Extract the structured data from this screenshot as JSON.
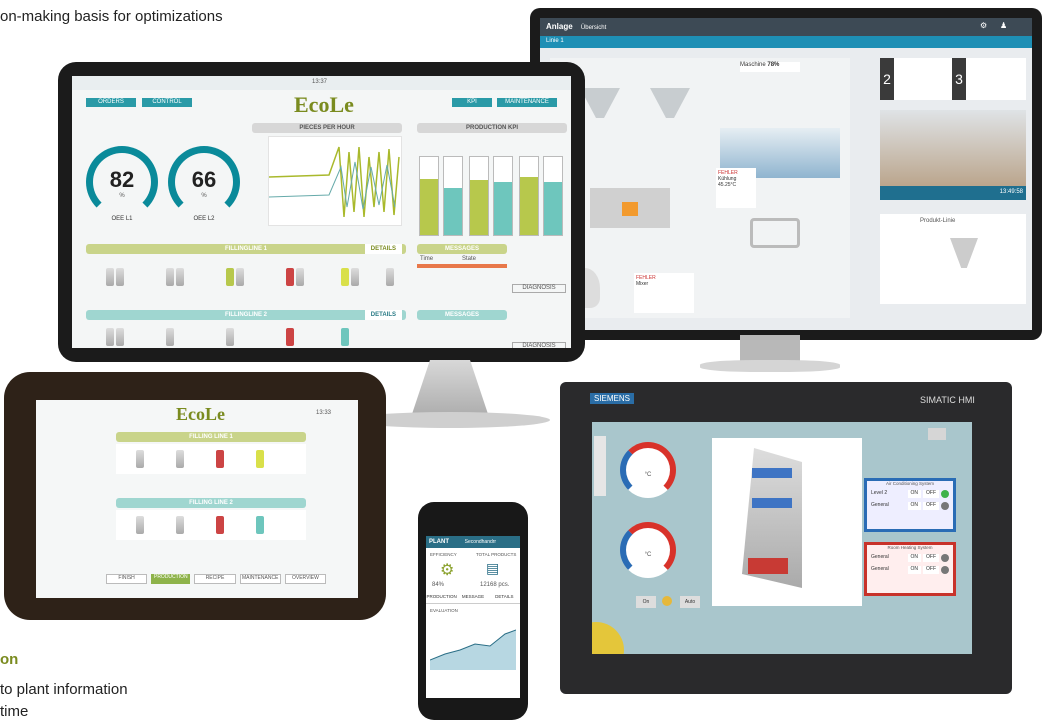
{
  "caption": {
    "top": "on-making basis for optimizations",
    "bottom_heading": "on",
    "bottom_line1": "to plant information",
    "bottom_line2": "time"
  },
  "laptop": {
    "tabs": [
      "ORDERS",
      "CONTROL",
      "KPI",
      "MAINTENANCE"
    ],
    "logo": "EcoLe",
    "time": "13:37",
    "pieces_header": "PIECES PER HOUR",
    "production_header": "PRODUCTION KPI",
    "gauges": [
      {
        "value": "82",
        "unit": "%",
        "label": "OEE L1"
      },
      {
        "value": "66",
        "unit": "%",
        "label": "OEE L2"
      }
    ],
    "line1_title": "FILLINGLINE 1",
    "line2_title": "FILLINGLINE 2",
    "details": "DETAILS",
    "diagnosis": "DIAGNOSIS",
    "messages": "MESSAGES",
    "time_col": "Time",
    "state_col": "State",
    "production_pct": [
      [
        "89 %",
        "75 %"
      ],
      [
        "87 %",
        "84 %"
      ],
      [
        "92 %",
        "84 %"
      ]
    ]
  },
  "right_monitor": {
    "title": "Anlage",
    "subtitle": "Übersicht",
    "unit": "Linie 1",
    "maschine": "Maschine",
    "percent": "78%",
    "kuehlung": "Kühlung",
    "mixer": "Mixer",
    "temp": "45.25°C",
    "fehler": "FEHLER",
    "num2": "2",
    "num3": "3",
    "clock": "13:49:58",
    "produkt": "Produkt-Linie"
  },
  "tablet": {
    "logo": "EcoLe",
    "time": "13:33",
    "line1": "FILLING LINE 1",
    "line2": "FILLING LINE 2",
    "buttons": [
      "FINISH",
      "PRODUCTION",
      "RECIPE",
      "MAINTENANCE",
      "OVERVIEW"
    ]
  },
  "phone": {
    "title": "PLANT",
    "subtitle": "Secondhandrr",
    "efficiency": "EFFICIENCY",
    "total": "TOTAL PRODUCTS",
    "eff_val": "84%",
    "total_val": "12168 pcs.",
    "tabs": [
      "PRODUCTION",
      "MESSAGE",
      "DETAILS"
    ],
    "evaluation": "EVALUATION"
  },
  "hmi": {
    "brand": "SIEMENS",
    "product": "SIMATIC HMI",
    "ac_title": "Air Conditioning System",
    "heat_title": "Room Heating System",
    "rows_ac": [
      [
        "Level 2",
        "ON",
        "OFF"
      ],
      [
        "General",
        "ON",
        "OFF"
      ]
    ],
    "rows_heat": [
      [
        "General",
        "ON",
        "OFF"
      ],
      [
        "General",
        "ON",
        "OFF"
      ]
    ],
    "btn_on": "On",
    "btn_auto": "Auto",
    "gauge_unit": "°C"
  }
}
